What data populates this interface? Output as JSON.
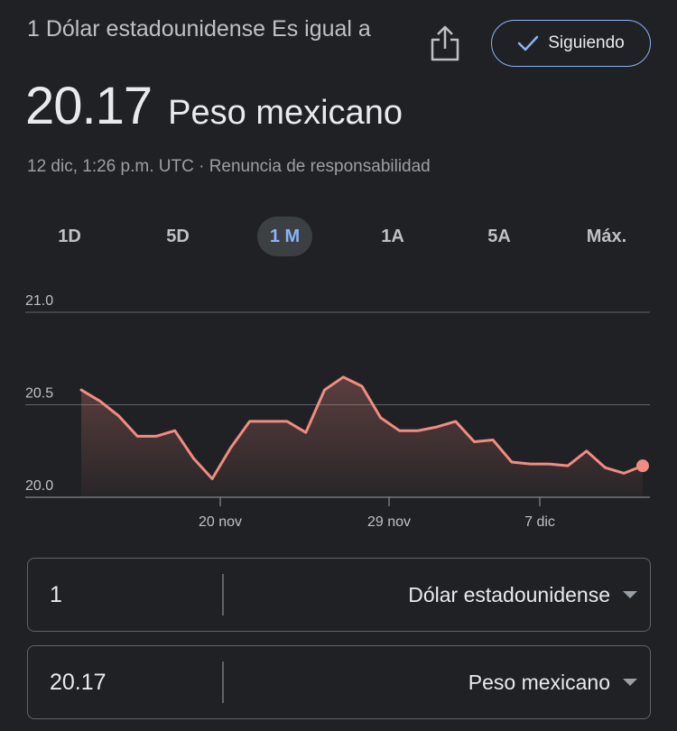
{
  "header": {
    "subtitle": "1 Dólar estadounidense Es igual a",
    "rate_value": "20.17",
    "rate_unit": "Peso mexicano",
    "follow_label": "Siguiendo",
    "share_icon": "share-icon",
    "check_icon": "check-icon"
  },
  "timestamp": {
    "time": "12 dic, 1:26 p.m. UTC · ",
    "disclaimer": "Renuncia de responsabilidad"
  },
  "ranges": {
    "active": "1 M",
    "items": [
      {
        "label": "1D"
      },
      {
        "label": "5D"
      },
      {
        "label": "1 M"
      },
      {
        "label": "1A"
      },
      {
        "label": "5A"
      },
      {
        "label": "Máx."
      }
    ]
  },
  "chart_data": {
    "type": "area",
    "title": "",
    "xlabel": "",
    "ylabel": "",
    "ylim": [
      20.0,
      21.0
    ],
    "y_ticks": [
      "21.0",
      "20.5",
      "20.0"
    ],
    "x_tick_labels": [
      "20 nov",
      "29 nov",
      "7 dic"
    ],
    "grid": true,
    "color": "#f28b82",
    "series": [
      {
        "values": [
          20.58,
          20.52,
          20.44,
          20.33,
          20.33,
          20.36,
          20.21,
          20.1,
          20.27,
          20.41,
          20.41,
          20.41,
          20.35,
          20.58,
          20.65,
          20.6,
          20.43,
          20.36,
          20.36,
          20.38,
          20.41,
          20.3,
          20.31,
          20.19,
          20.18,
          20.18,
          20.17,
          20.25,
          20.16,
          20.13,
          20.17
        ]
      }
    ]
  },
  "converter": {
    "from_amount": "1",
    "from_currency": "Dólar estadounidense",
    "to_amount": "20.17",
    "to_currency": "Peso mexicano"
  }
}
